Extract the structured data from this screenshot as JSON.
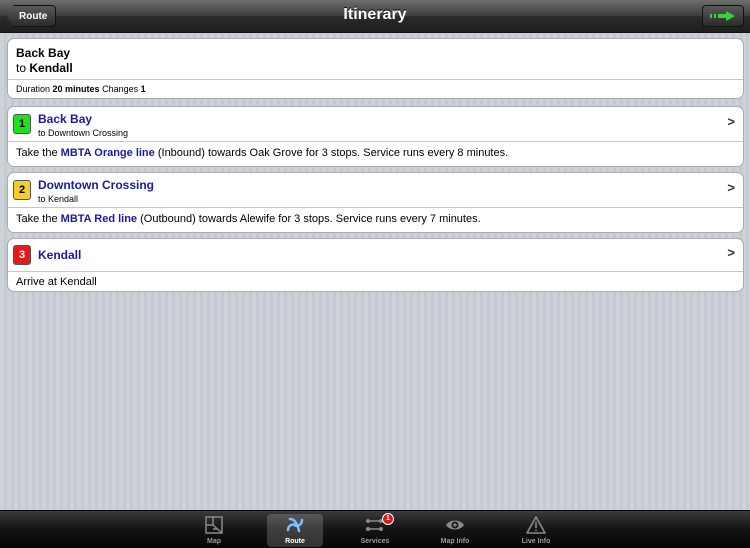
{
  "header": {
    "title": "Itinerary",
    "back_label": "Route"
  },
  "summary": {
    "from": "Back Bay",
    "to_prefix": "to",
    "to": "Kendall",
    "duration_label": "Duration",
    "duration": "20 minutes",
    "changes_label": "Changes",
    "changes": "1"
  },
  "steps": [
    {
      "number": "1",
      "color": "#1fe01f",
      "station": "Back Bay",
      "subtitle": "to Downtown Crossing",
      "desc_pre": "Take the",
      "line": "MBTA Orange line",
      "desc_post": "(Inbound) towards Oak Grove for 3 stops. Service runs every 8 minutes."
    },
    {
      "number": "2",
      "color": "#f5cb2e",
      "station": "Downtown Crossing",
      "subtitle": "to Kendall",
      "desc_pre": "Take the",
      "line": "MBTA Red line",
      "desc_post": "(Outbound) towards Alewife for 3 stops. Service runs every 7 minutes."
    },
    {
      "number": "3",
      "color": "#e61a1a",
      "station": "Kendall",
      "description": "Arrive at Kendall"
    }
  ],
  "chevron": ">",
  "tabbar": {
    "tabs": [
      {
        "label": "Map",
        "icon": "map-icon"
      },
      {
        "label": "Route",
        "icon": "route-icon",
        "active": true
      },
      {
        "label": "Services",
        "icon": "services-icon",
        "badge": "1"
      },
      {
        "label": "Map Info",
        "icon": "eye-icon"
      },
      {
        "label": "Live Info",
        "icon": "warning-icon"
      }
    ]
  }
}
